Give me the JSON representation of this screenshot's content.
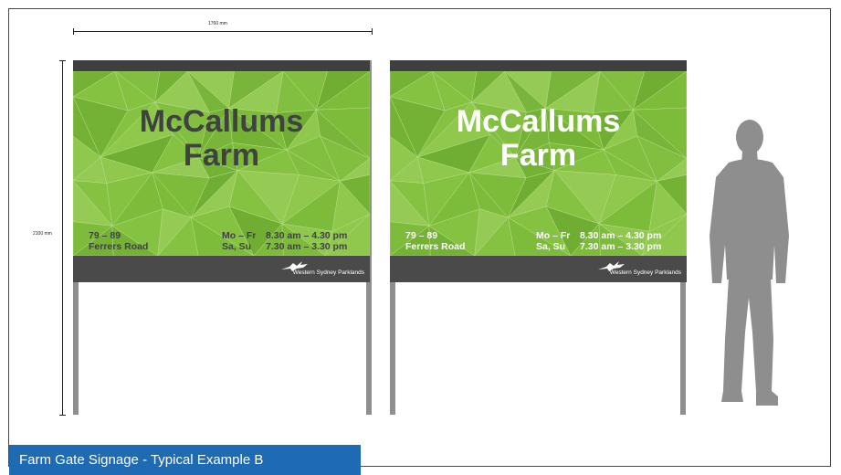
{
  "dimensions": {
    "width_label": "1760 mm",
    "height_label": "2100 mm"
  },
  "signs": [
    {
      "title_line1": "McCallums",
      "title_line2": "Farm",
      "address_line1": "79 – 89",
      "address_line2": "Ferrers Road",
      "days_line1": "Mo – Fr",
      "days_line2": "Sa, Su",
      "hours_line1": "8.30 am – 4.30 pm",
      "hours_line2": "7.30 am – 3.30 pm",
      "logo_text": "Western Sydney Parklands",
      "text_color": "#3f4240"
    },
    {
      "title_line1": "McCallums",
      "title_line2": "Farm",
      "address_line1": "79 – 89",
      "address_line2": "Ferrers Road",
      "days_line1": "Mo – Fr",
      "days_line2": "Sa, Su",
      "hours_line1": "8.30 am – 4.30 pm",
      "hours_line2": "7.30 am – 3.30 pm",
      "logo_text": "Western Sydney Parklands",
      "text_color": "#ffffff"
    }
  ],
  "caption": "Farm Gate Signage - Typical Example B",
  "colors": {
    "panel_green": "#7dbb3a",
    "panel_dark": "#4a4a4b",
    "post_grey": "#8f8f8f",
    "figure_grey": "#8e8e8e",
    "caption_blue": "#1e6ab3"
  }
}
